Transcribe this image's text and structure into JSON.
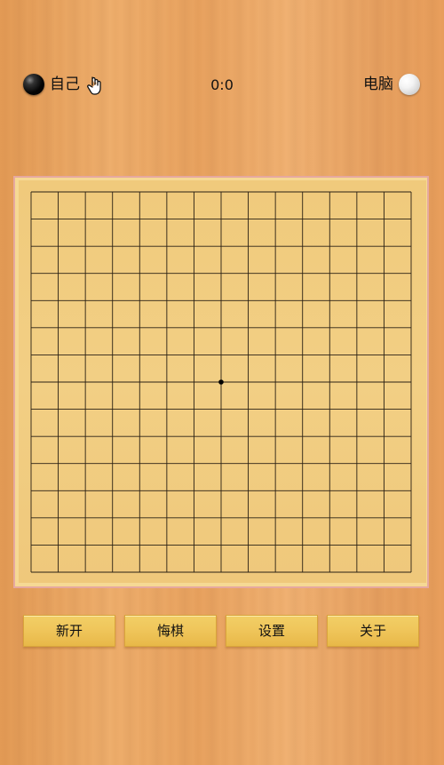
{
  "header": {
    "player_label": "自己",
    "score": "0:0",
    "opponent_label": "电脑",
    "player_stone": "black-stone",
    "opponent_stone": "white-stone",
    "turn_indicator_icon": "hand-pointer-icon"
  },
  "board": {
    "lines": 15,
    "center_mark": "tengen-star-point",
    "line_color": "#2a2014"
  },
  "buttons": {
    "new_game": "新开",
    "undo": "悔棋",
    "settings": "设置",
    "about": "关于"
  },
  "colors": {
    "background_wood": "#eaa663",
    "board": "#f1cc80",
    "button": "#efc55a"
  }
}
